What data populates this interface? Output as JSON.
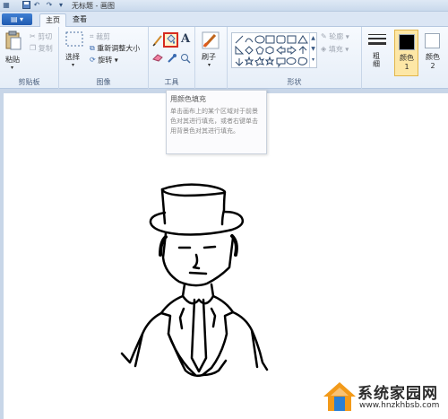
{
  "window": {
    "title": "无标题 - 画图"
  },
  "quick_access": [
    "save-icon",
    "undo-icon",
    "redo-icon",
    "customize-icon"
  ],
  "tabs": {
    "file": "",
    "home": "主页",
    "view": "查看"
  },
  "clipboard": {
    "paste": "粘贴",
    "cut": "剪切",
    "copy": "复制",
    "label": "剪贴板"
  },
  "image": {
    "select": "选择",
    "crop": "裁剪",
    "resize": "重新调整大小",
    "rotate": "旋转",
    "label": "图像"
  },
  "tools": {
    "label": "工具",
    "active_tool": "fill-icon"
  },
  "brushes": {
    "label": "刷子"
  },
  "shapes": {
    "outline": "轮廓",
    "fill": "填充",
    "label": "形状"
  },
  "size": {
    "label": "粗细"
  },
  "colors": {
    "color1": "颜色 1",
    "color2": "颜色 2",
    "color1_value": "#000000",
    "color2_value": "#ffffff"
  },
  "tooltip": {
    "title": "用颜色填充",
    "body": "单击画布上的某个区域对于前景色对其进行填充，或者右键单击用背景色对其进行填充。"
  },
  "watermark": {
    "title": "系统家园网",
    "url": "www.hnzkhbsb.com"
  }
}
